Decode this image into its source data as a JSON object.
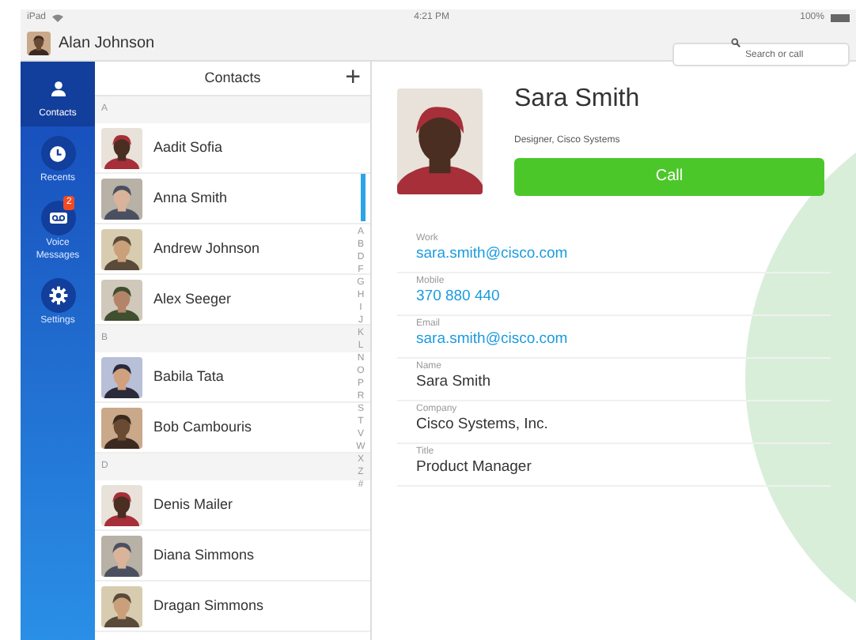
{
  "status_bar": {
    "device": "iPad",
    "time": "4:21 PM",
    "battery": "100%"
  },
  "header": {
    "user": "Alan Johnson",
    "search": {
      "placeholder": "Search or call"
    }
  },
  "sidebar": {
    "items": [
      {
        "label": "Contacts",
        "selected": true
      },
      {
        "label": "Recents",
        "selected": false
      },
      {
        "label": "Voice Messages",
        "selected": false,
        "badge": "2"
      },
      {
        "label": "Settings",
        "selected": false
      }
    ]
  },
  "contacts": {
    "title": "Contacts",
    "add_button": "+",
    "sections": [
      {
        "letter": "A",
        "contacts": [
          {
            "name": "Aadit Sofia"
          },
          {
            "name": "Anna Smith"
          },
          {
            "name": "Andrew Johnson"
          },
          {
            "name": "Alex Seeger"
          }
        ]
      },
      {
        "letter": "B",
        "contacts": [
          {
            "name": "Babila Tata"
          },
          {
            "name": "Bob Cambouris"
          }
        ]
      },
      {
        "letter": "D",
        "contacts": [
          {
            "name": "Denis Mailer"
          },
          {
            "name": "Diana Simmons"
          },
          {
            "name": "Dragan Simmons"
          }
        ]
      }
    ],
    "index": [
      "A",
      "B",
      "D",
      "F",
      "G",
      "H",
      "I",
      "J",
      "K",
      "L",
      "N",
      "O",
      "P",
      "R",
      "S",
      "T",
      "V",
      "W",
      "X",
      "Z",
      "#"
    ]
  },
  "detail": {
    "name": "Sara Smith",
    "subtitle": "Designer, Cisco Systems",
    "call_button": "Call",
    "fields": [
      {
        "label": "Work",
        "value": "sara.smith@cisco.com",
        "kind": "link"
      },
      {
        "label": "Mobile",
        "value": "370 880 440",
        "kind": "link"
      },
      {
        "label": "Email",
        "value": "sara.smith@cisco.com",
        "kind": "link"
      },
      {
        "label": "Name",
        "value": "Sara Smith",
        "kind": "text"
      },
      {
        "label": "Company",
        "value": "Cisco Systems, Inc.",
        "kind": "text"
      },
      {
        "label": "Title",
        "value": "Product Manager",
        "kind": "text"
      }
    ]
  }
}
